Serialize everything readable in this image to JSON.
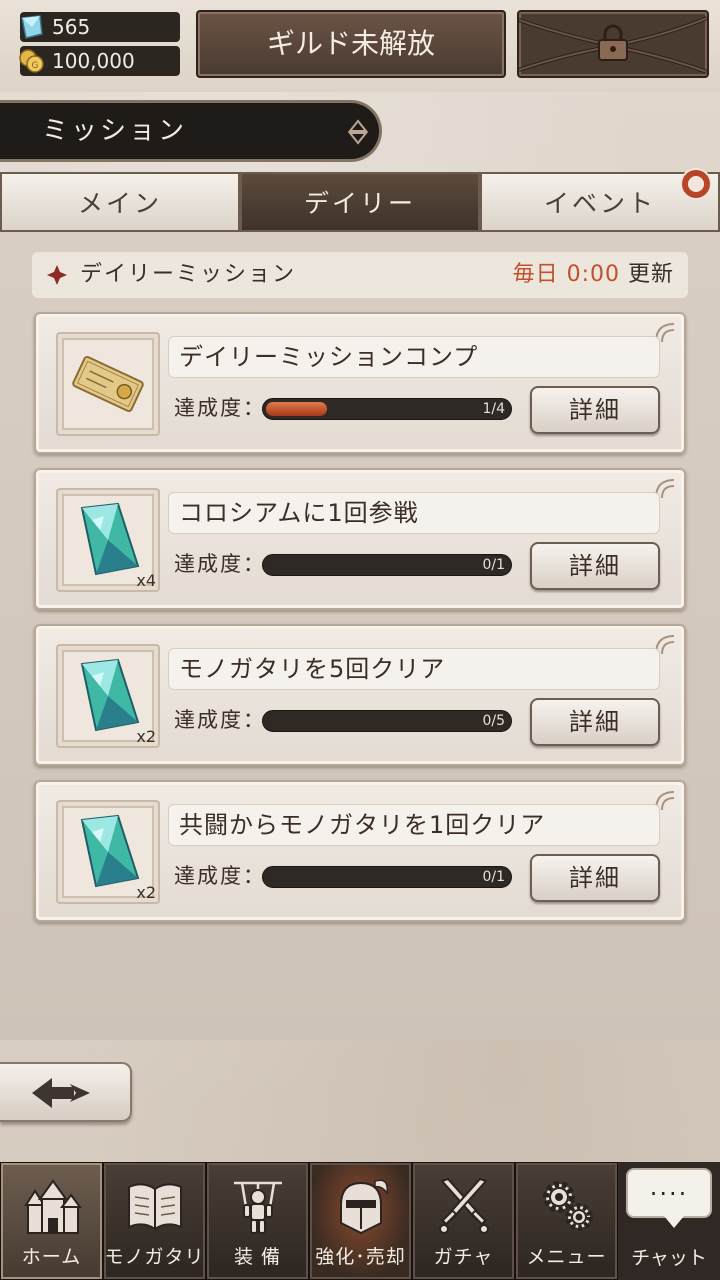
{
  "header": {
    "crystals": "565",
    "coins": "100,000",
    "guild_button": "ギルド未解放"
  },
  "title": "ミッション",
  "tabs": [
    {
      "label": "メイン",
      "active": false
    },
    {
      "label": "デイリー",
      "active": true
    },
    {
      "label": "イベント",
      "active": false
    }
  ],
  "section": {
    "title": "デイリーミッション",
    "reset_prefix": "毎日",
    "reset_time": "0:00",
    "reset_suffix": "更新"
  },
  "progress_label": "達成度：",
  "missions": [
    {
      "title": "デイリーミッションコンプ",
      "progress_text": "1/4",
      "progress": 0.25,
      "reward_icon": "ticket-icon",
      "reward_qty": "",
      "detail_label": "詳細"
    },
    {
      "title": "コロシアムに1回参戦",
      "progress_text": "0/1",
      "progress": 0,
      "reward_icon": "crystal-icon",
      "reward_qty": "x4",
      "detail_label": "詳細"
    },
    {
      "title": "モノガタリを5回クリア",
      "progress_text": "0/5",
      "progress": 0,
      "reward_icon": "crystal-icon",
      "reward_qty": "x2",
      "detail_label": "詳細"
    },
    {
      "title": "共闘からモノガタリを1回クリア",
      "progress_text": "0/1",
      "progress": 0,
      "reward_icon": "crystal-icon",
      "reward_qty": "x2",
      "detail_label": "詳細"
    }
  ],
  "nav": [
    {
      "label": "ホーム",
      "icon": "home-icon",
      "active": true
    },
    {
      "label": "モノガタリ",
      "icon": "book-icon",
      "active": false
    },
    {
      "label": "装 備",
      "icon": "puppet-icon",
      "active": false
    },
    {
      "label": "強化･売却",
      "icon": "helmet-icon",
      "active": false
    },
    {
      "label": "ガチャ",
      "icon": "swords-icon",
      "active": false
    },
    {
      "label": "メニュー",
      "icon": "gears-icon",
      "active": false
    }
  ],
  "chat": {
    "bubble": "....",
    "label": "チャット"
  },
  "colors": {
    "accent": "#c0512a",
    "progress_fill": "#c9532a",
    "active_tab": "#4a3b31"
  }
}
